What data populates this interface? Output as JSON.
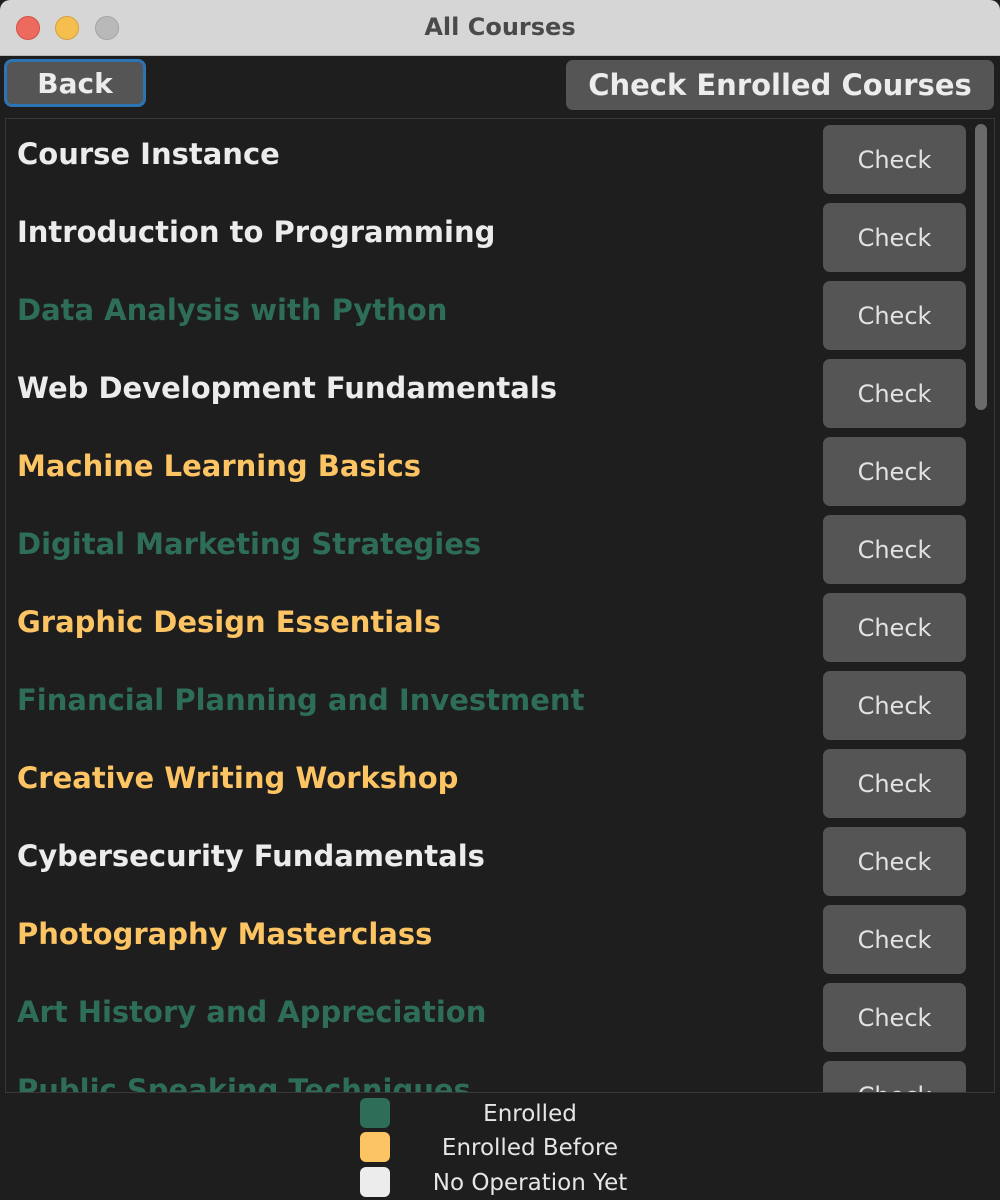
{
  "window": {
    "title": "All Courses"
  },
  "toolbar": {
    "back_label": "Back",
    "enrolled_label": "Check Enrolled Courses"
  },
  "colors": {
    "enrolled": "#2e6e58",
    "enrolled_before": "#fdc463",
    "no_operation": "#ececec"
  },
  "courses": [
    {
      "name": "Course Instance",
      "status": "no_operation",
      "button": "Check"
    },
    {
      "name": "Introduction to Programming",
      "status": "no_operation",
      "button": "Check"
    },
    {
      "name": "Data Analysis with Python",
      "status": "enrolled",
      "button": "Check"
    },
    {
      "name": "Web Development Fundamentals",
      "status": "no_operation",
      "button": "Check"
    },
    {
      "name": "Machine Learning Basics",
      "status": "enrolled_before",
      "button": "Check"
    },
    {
      "name": "Digital Marketing Strategies",
      "status": "enrolled",
      "button": "Check"
    },
    {
      "name": "Graphic Design Essentials",
      "status": "enrolled_before",
      "button": "Check"
    },
    {
      "name": "Financial Planning and Investment",
      "status": "enrolled",
      "button": "Check"
    },
    {
      "name": "Creative Writing Workshop",
      "status": "enrolled_before",
      "button": "Check"
    },
    {
      "name": "Cybersecurity Fundamentals",
      "status": "no_operation",
      "button": "Check"
    },
    {
      "name": "Photography Masterclass",
      "status": "enrolled_before",
      "button": "Check"
    },
    {
      "name": "Art History and Appreciation",
      "status": "enrolled",
      "button": "Check"
    },
    {
      "name": "Public Speaking Techniques",
      "status": "enrolled",
      "button": "Check"
    }
  ],
  "legend": [
    {
      "label": "Enrolled",
      "status": "enrolled"
    },
    {
      "label": "Enrolled Before",
      "status": "enrolled_before"
    },
    {
      "label": "No Operation Yet",
      "status": "no_operation"
    }
  ]
}
